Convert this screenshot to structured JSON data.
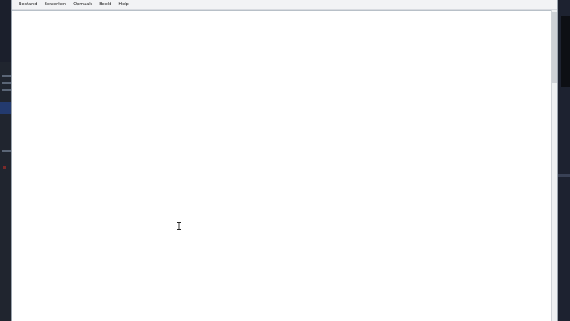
{
  "menubar": {
    "items": [
      {
        "label": "Bestand"
      },
      {
        "label": "Bewerken"
      },
      {
        "label": "Opmaak"
      },
      {
        "label": "Beeld"
      },
      {
        "label": "Help"
      }
    ]
  },
  "editor": {
    "text": ""
  },
  "pointer": {
    "icon": "text-ibeam-cursor-icon"
  },
  "colors": {
    "window_bg": "#ffffff",
    "menubar_bg": "#f2f3f5",
    "desktop_bg": "#1b1f2c"
  }
}
